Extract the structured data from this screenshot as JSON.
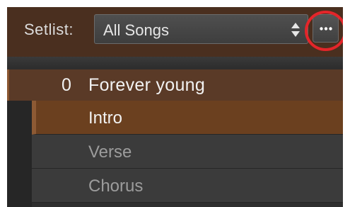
{
  "header": {
    "setlist_label": "Setlist:",
    "setlist_value": "All Songs",
    "more_label": "•••"
  },
  "song": {
    "number": "0",
    "title": "Forever young"
  },
  "parts": [
    {
      "label": "Intro",
      "selected": true
    },
    {
      "label": "Verse",
      "selected": false
    },
    {
      "label": "Chorus",
      "selected": false
    }
  ],
  "colors": {
    "header_bg": "#4a2f1f",
    "selected_bg": "#6b401f",
    "highlight_ring": "#e4252a"
  }
}
